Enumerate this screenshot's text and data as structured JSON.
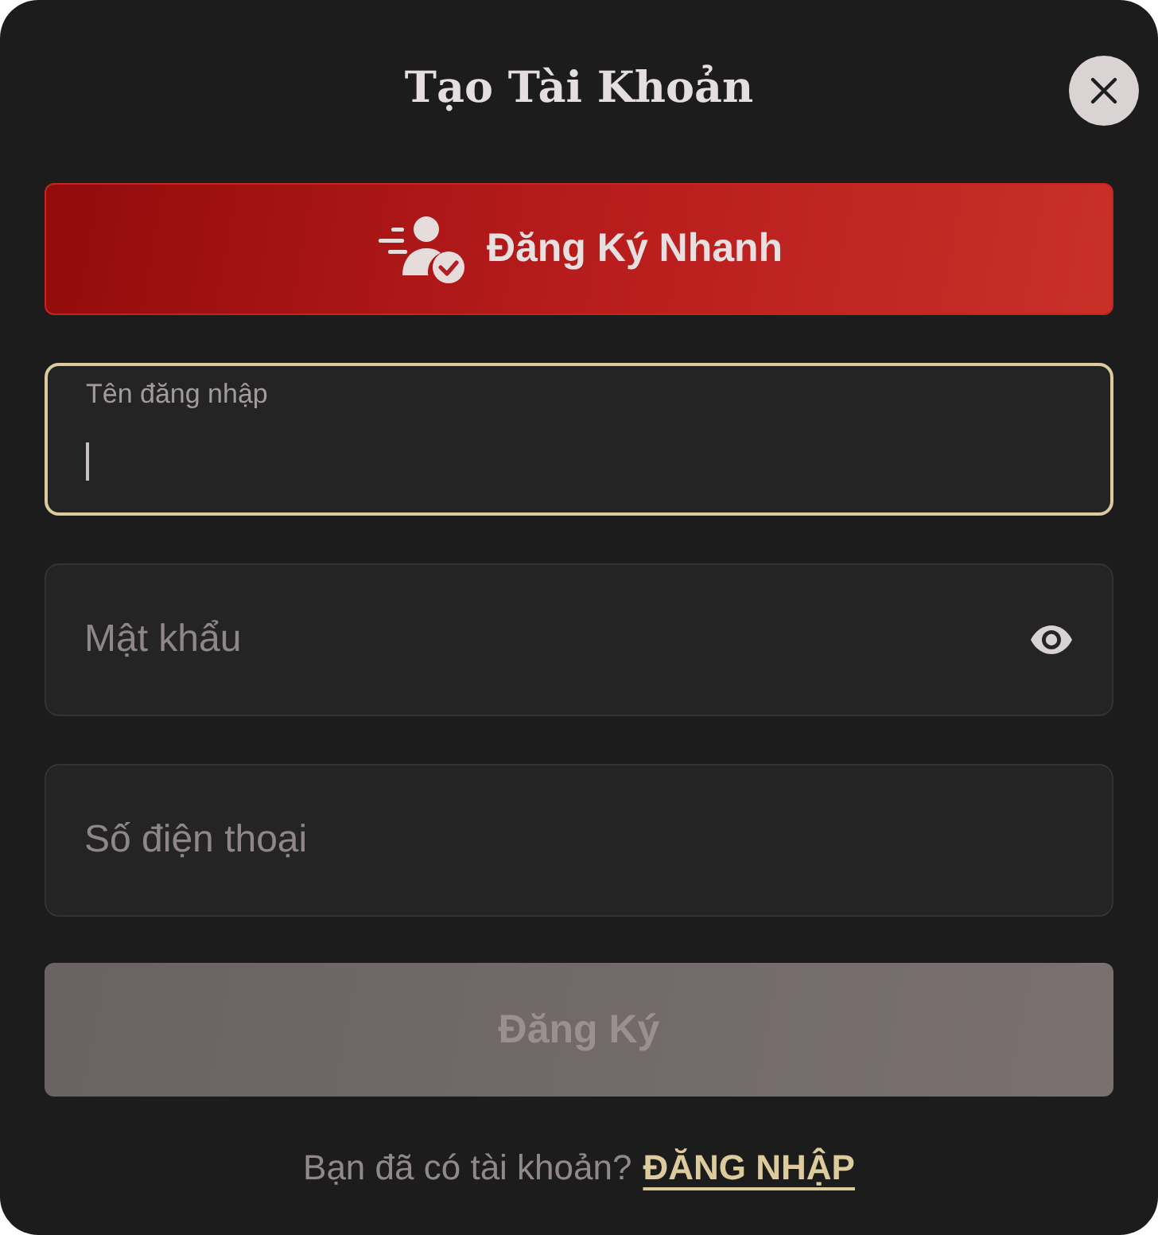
{
  "dialog": {
    "title": "Tạo Tài Khoản"
  },
  "quick_signup_button": {
    "label": "Đăng Ký Nhanh"
  },
  "fields": [
    {
      "kind": "text",
      "placeholder": "Tên đăng nhập",
      "focused": true
    },
    {
      "kind": "password",
      "placeholder": "Mật khẩu",
      "focused": false
    },
    {
      "kind": "text",
      "placeholder": "Số điện thoại",
      "focused": false
    }
  ],
  "submit_button": {
    "label": "Đăng Ký",
    "disabled": true
  },
  "footer": {
    "prompt": "Bạn đã có tài khoản?",
    "link": "ĐĂNG NHẬP"
  }
}
